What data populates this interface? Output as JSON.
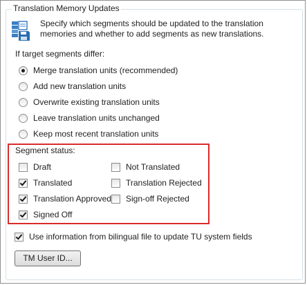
{
  "group": {
    "title": "Translation Memory Updates",
    "icon": "tm-database-icon",
    "description": "Specify which segments should be updated to the translation memories and whether to add segments as new translations."
  },
  "target_differ": {
    "label": "If target segments differ:",
    "options": [
      {
        "label": "Merge translation units (recommended)",
        "selected": true
      },
      {
        "label": "Add new translation units",
        "selected": false
      },
      {
        "label": "Overwrite existing translation units",
        "selected": false
      },
      {
        "label": "Leave translation units unchanged",
        "selected": false
      },
      {
        "label": "Keep most recent translation units",
        "selected": false
      }
    ]
  },
  "segment_status": {
    "label": "Segment status:",
    "highlight_color": "#d92a2a",
    "items": [
      {
        "label": "Draft",
        "checked": false
      },
      {
        "label": "Translated",
        "checked": true
      },
      {
        "label": "Translation Approved",
        "checked": true
      },
      {
        "label": "Signed Off",
        "checked": true
      },
      {
        "label": "Not Translated",
        "checked": false
      },
      {
        "label": "Translation Rejected",
        "checked": false
      },
      {
        "label": "Sign-off Rejected",
        "checked": false
      }
    ]
  },
  "bilingual": {
    "label": "Use information from bilingual file to update TU system fields",
    "checked": true
  },
  "tm_user_button": {
    "label": "TM User ID..."
  }
}
